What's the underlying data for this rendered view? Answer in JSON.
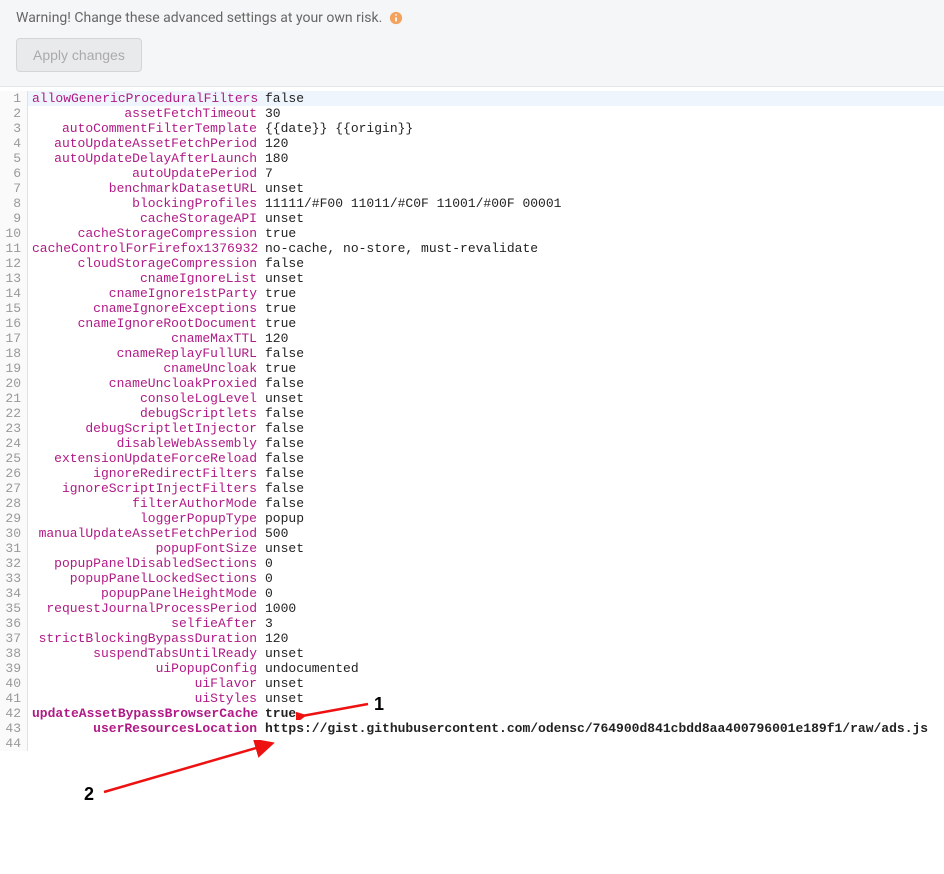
{
  "warning_text": "Warning! Change these advanced settings at your own risk.",
  "apply_label": "Apply changes",
  "annotation_labels": {
    "one": "1",
    "two": "2"
  },
  "settings": [
    {
      "key": "allowGenericProceduralFilters",
      "value": "false"
    },
    {
      "key": "assetFetchTimeout",
      "value": "30"
    },
    {
      "key": "autoCommentFilterTemplate",
      "value": "{{date}} {{origin}}"
    },
    {
      "key": "autoUpdateAssetFetchPeriod",
      "value": "120"
    },
    {
      "key": "autoUpdateDelayAfterLaunch",
      "value": "180"
    },
    {
      "key": "autoUpdatePeriod",
      "value": "7"
    },
    {
      "key": "benchmarkDatasetURL",
      "value": "unset"
    },
    {
      "key": "blockingProfiles",
      "value": "11111/#F00 11011/#C0F 11001/#00F 00001"
    },
    {
      "key": "cacheStorageAPI",
      "value": "unset"
    },
    {
      "key": "cacheStorageCompression",
      "value": "true"
    },
    {
      "key": "cacheControlForFirefox1376932",
      "value": "no-cache, no-store, must-revalidate"
    },
    {
      "key": "cloudStorageCompression",
      "value": "false"
    },
    {
      "key": "cnameIgnoreList",
      "value": "unset"
    },
    {
      "key": "cnameIgnore1stParty",
      "value": "true"
    },
    {
      "key": "cnameIgnoreExceptions",
      "value": "true"
    },
    {
      "key": "cnameIgnoreRootDocument",
      "value": "true"
    },
    {
      "key": "cnameMaxTTL",
      "value": "120"
    },
    {
      "key": "cnameReplayFullURL",
      "value": "false"
    },
    {
      "key": "cnameUncloak",
      "value": "true"
    },
    {
      "key": "cnameUncloakProxied",
      "value": "false"
    },
    {
      "key": "consoleLogLevel",
      "value": "unset"
    },
    {
      "key": "debugScriptlets",
      "value": "false"
    },
    {
      "key": "debugScriptletInjector",
      "value": "false"
    },
    {
      "key": "disableWebAssembly",
      "value": "false"
    },
    {
      "key": "extensionUpdateForceReload",
      "value": "false"
    },
    {
      "key": "ignoreRedirectFilters",
      "value": "false"
    },
    {
      "key": "ignoreScriptInjectFilters",
      "value": "false"
    },
    {
      "key": "filterAuthorMode",
      "value": "false"
    },
    {
      "key": "loggerPopupType",
      "value": "popup"
    },
    {
      "key": "manualUpdateAssetFetchPeriod",
      "value": "500"
    },
    {
      "key": "popupFontSize",
      "value": "unset"
    },
    {
      "key": "popupPanelDisabledSections",
      "value": "0"
    },
    {
      "key": "popupPanelLockedSections",
      "value": "0"
    },
    {
      "key": "popupPanelHeightMode",
      "value": "0"
    },
    {
      "key": "requestJournalProcessPeriod",
      "value": "1000"
    },
    {
      "key": "selfieAfter",
      "value": "3"
    },
    {
      "key": "strictBlockingBypassDuration",
      "value": "120"
    },
    {
      "key": "suspendTabsUntilReady",
      "value": "unset"
    },
    {
      "key": "uiPopupConfig",
      "value": "undocumented"
    },
    {
      "key": "uiFlavor",
      "value": "unset"
    },
    {
      "key": "uiStyles",
      "value": "unset"
    },
    {
      "key": "updateAssetBypassBrowserCache",
      "value": "true",
      "bold": true
    },
    {
      "key": "userResourcesLocation",
      "value": "https://gist.githubusercontent.com/odensc/764900d841cbdd8aa400796001e189f1/raw/ads.js",
      "bold": true
    }
  ]
}
